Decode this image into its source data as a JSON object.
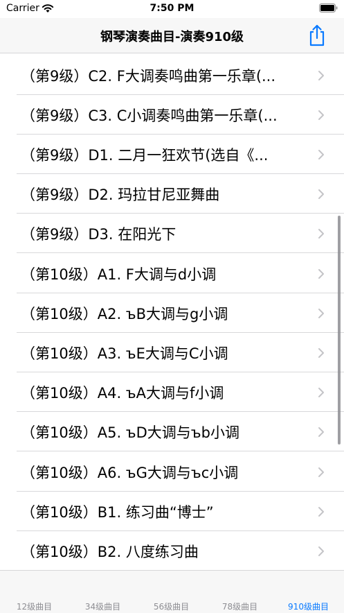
{
  "status_bar": {
    "carrier": "Carrier",
    "time": "7:50 PM"
  },
  "nav": {
    "title": "钢琴演奏曲目-演奏910级",
    "share_icon": "share-icon"
  },
  "list": {
    "items": [
      {
        "label": "（第9级）C2. F大调奏鸣曲第一乐章(..."
      },
      {
        "label": "（第9级）C3. C小调奏鸣曲第一乐章(..."
      },
      {
        "label": "（第9级）D1. 二月一狂欢节(选自《..."
      },
      {
        "label": "（第9级）D2. 玛拉甘尼亚舞曲"
      },
      {
        "label": "（第9级）D3. 在阳光下"
      },
      {
        "label": "（第10级）A1. F大调与d小调"
      },
      {
        "label": "（第10级）A2. ъB大调与g小调"
      },
      {
        "label": "（第10级）A3. ъE大调与C小调"
      },
      {
        "label": "（第10级）A4. ъA大调与f小调"
      },
      {
        "label": "（第10级）A5. ъD大调与ъb小调"
      },
      {
        "label": "（第10级）A6. ъG大调与ъc小调"
      },
      {
        "label": "（第10级）B1. 练习曲“博士”"
      },
      {
        "label": "（第10级）B2. 八度练习曲"
      }
    ]
  },
  "tabs": [
    {
      "label": "12级曲目",
      "active": false
    },
    {
      "label": "34级曲目",
      "active": false
    },
    {
      "label": "56级曲目",
      "active": false
    },
    {
      "label": "78级曲目",
      "active": false
    },
    {
      "label": "910级曲目",
      "active": true
    }
  ],
  "colors": {
    "accent": "#0a7aff",
    "tab_inactive": "#8e8e93",
    "separator": "#d8d8da"
  }
}
